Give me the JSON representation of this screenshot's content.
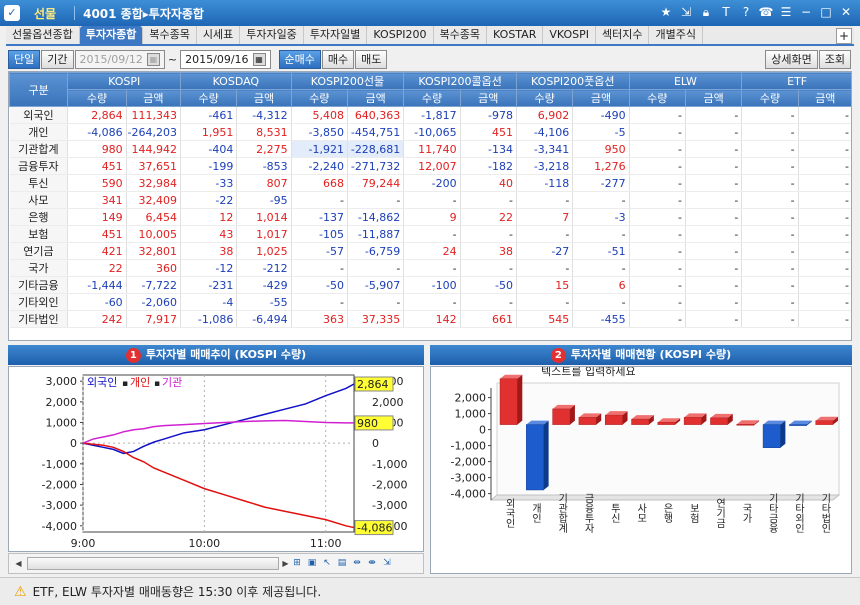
{
  "window": {
    "module": "선물",
    "screen_title": "4001 종합▸투자자종합"
  },
  "tabs": [
    "선물옵션종합",
    "투자자종합",
    "복수종목",
    "시세표",
    "투자자일중",
    "투자자일별",
    "KOSPI200",
    "복수종목",
    "KOSTAR",
    "VKOSPI",
    "섹터지수",
    "개별주식"
  ],
  "toolbar": {
    "single": "단일",
    "period": "기간",
    "date_from": "2015/09/12",
    "date_to": "2015/09/16",
    "tilde": "~",
    "net_buy": "순매수",
    "buy": "매수",
    "sell": "매도",
    "detail": "상세화면",
    "query": "조회"
  },
  "table": {
    "group_header": "구분",
    "groups": [
      "KOSPI",
      "KOSDAQ",
      "KOSPI200선물",
      "KOSPI200콜옵션",
      "KOSPI200풋옵션",
      "ELW",
      "ETF"
    ],
    "sub_qty": "수량",
    "sub_amt": "금액",
    "rows": [
      {
        "label": "외국인",
        "v": [
          "2,864",
          "111,343",
          "-461",
          "-4,312",
          "5,408",
          "640,363",
          "-1,817",
          "-978",
          "6,902",
          "-490",
          "-",
          "-",
          "-",
          "-"
        ]
      },
      {
        "label": "개인",
        "v": [
          "-4,086",
          "-264,203",
          "1,951",
          "8,531",
          "-3,850",
          "-454,751",
          "-10,065",
          "451",
          "-4,106",
          "-5",
          "-",
          "-",
          "-",
          "-"
        ]
      },
      {
        "label": "기관합계",
        "v": [
          "980",
          "144,942",
          "-404",
          "2,275",
          "-1,921",
          "-228,681",
          "11,740",
          "-134",
          "-3,341",
          "950",
          "-",
          "-",
          "-",
          "-"
        ]
      },
      {
        "label": "금융투자",
        "v": [
          "451",
          "37,651",
          "-199",
          "-853",
          "-2,240",
          "-271,732",
          "12,007",
          "-182",
          "-3,218",
          "1,276",
          "-",
          "-",
          "-",
          "-"
        ]
      },
      {
        "label": "투신",
        "v": [
          "590",
          "32,984",
          "-33",
          "807",
          "668",
          "79,244",
          "-200",
          "40",
          "-118",
          "-277",
          "-",
          "-",
          "-",
          "-"
        ]
      },
      {
        "label": "사모",
        "v": [
          "341",
          "32,409",
          "-22",
          "-95",
          "-",
          "-",
          "-",
          "-",
          "-",
          "-",
          "-",
          "-",
          "-",
          "-"
        ]
      },
      {
        "label": "은행",
        "v": [
          "149",
          "6,454",
          "12",
          "1,014",
          "-137",
          "-14,862",
          "9",
          "22",
          "7",
          "-3",
          "-",
          "-",
          "-",
          "-"
        ]
      },
      {
        "label": "보험",
        "v": [
          "451",
          "10,005",
          "43",
          "1,017",
          "-105",
          "-11,887",
          "-",
          "-",
          "-",
          "-",
          "-",
          "-",
          "-",
          "-"
        ]
      },
      {
        "label": "연기금",
        "v": [
          "421",
          "32,801",
          "38",
          "1,025",
          "-57",
          "-6,759",
          "24",
          "38",
          "-27",
          "-51",
          "-",
          "-",
          "-",
          "-"
        ]
      },
      {
        "label": "국가",
        "v": [
          "22",
          "360",
          "-12",
          "-212",
          "-",
          "-",
          "-",
          "-",
          "-",
          "-",
          "-",
          "-",
          "-",
          "-"
        ]
      },
      {
        "label": "기타금융",
        "v": [
          "-1,444",
          "-7,722",
          "-231",
          "-429",
          "-50",
          "-5,907",
          "-100",
          "-50",
          "15",
          "6",
          "-",
          "-",
          "-",
          "-"
        ]
      },
      {
        "label": "기타외인",
        "v": [
          "-60",
          "-2,060",
          "-4",
          "-55",
          "-",
          "-",
          "-",
          "-",
          "-",
          "-",
          "-",
          "-",
          "-",
          "-"
        ]
      },
      {
        "label": "기타법인",
        "v": [
          "242",
          "7,917",
          "-1,086",
          "-6,494",
          "363",
          "37,335",
          "142",
          "661",
          "545",
          "-455",
          "-",
          "-",
          "-",
          "-"
        ]
      }
    ]
  },
  "panel1": {
    "badge": "1",
    "title": "투자자별 매매추이 (KOSPI 수량)"
  },
  "panel2": {
    "badge": "2",
    "title": "투자자별 매매현황 (KOSPI 수량)"
  },
  "chart_data": [
    {
      "type": "line",
      "legend": [
        "외국인",
        "개인",
        "기관"
      ],
      "legend_sep": "▪",
      "colors": {
        "외국인": "#1010c8",
        "개인": "#e01010",
        "기관": "#d020d0"
      },
      "x_ticks": [
        "9:00",
        "10:00",
        "11:00"
      ],
      "ylim": [
        -4300,
        3300
      ],
      "y_ticks": [
        3000,
        2000,
        1000,
        0,
        -1000,
        -2000,
        -3000,
        -4000
      ],
      "y_tick_labels": [
        "3,000",
        "2,000",
        "1,000",
        "0",
        "-1,000",
        "-2,000",
        "-3,000",
        "-4,000"
      ],
      "last_value_labels": {
        "외국인": "2,864",
        "기관": "980",
        "개인": "-4,086"
      },
      "series": [
        {
          "name": "외국인",
          "x": [
            0,
            5,
            10,
            15,
            20,
            25,
            30,
            35,
            40,
            50,
            60,
            70,
            80,
            90,
            100,
            110,
            120,
            130,
            134
          ],
          "values": [
            0,
            -100,
            -200,
            -300,
            -500,
            -400,
            -150,
            50,
            200,
            500,
            650,
            900,
            1150,
            1400,
            1650,
            1900,
            2300,
            2650,
            2864
          ]
        },
        {
          "name": "개인",
          "x": [
            0,
            5,
            10,
            15,
            20,
            25,
            30,
            35,
            40,
            50,
            60,
            70,
            80,
            90,
            100,
            110,
            120,
            130,
            134
          ],
          "values": [
            0,
            -50,
            -100,
            -200,
            -400,
            -700,
            -900,
            -1200,
            -1400,
            -1800,
            -2200,
            -2500,
            -2800,
            -3100,
            -3300,
            -3500,
            -3700,
            -4000,
            -4086
          ]
        },
        {
          "name": "기관",
          "x": [
            0,
            5,
            10,
            15,
            20,
            25,
            30,
            35,
            40,
            50,
            60,
            70,
            80,
            90,
            100,
            110,
            120,
            130,
            134
          ],
          "values": [
            0,
            200,
            300,
            400,
            550,
            650,
            700,
            800,
            850,
            900,
            950,
            1000,
            1050,
            1080,
            1100,
            1050,
            1000,
            980,
            980
          ]
        }
      ]
    },
    {
      "type": "bar",
      "title": "텍스트를 입력하세요",
      "categories": [
        "외국인",
        "개인",
        "기관합계",
        "금융투자",
        "투신",
        "사모",
        "은행",
        "보험",
        "연기금",
        "국가",
        "기타금융",
        "기타외인",
        "기타법인"
      ],
      "values": [
        2864,
        -4086,
        980,
        451,
        590,
        341,
        149,
        451,
        421,
        22,
        -1444,
        -60,
        242
      ],
      "ylim": [
        -4400,
        2600
      ],
      "y_ticks": [
        2000,
        1000,
        0,
        -1000,
        -2000,
        -3000,
        -4000
      ],
      "y_tick_labels": [
        "2,000",
        "1,000",
        "0",
        "-1,000",
        "-2,000",
        "-3,000",
        "-4,000"
      ],
      "colors": {
        "positive": "#e03030",
        "negative": "#1c5ccc"
      }
    }
  ],
  "notice": "ETF, ELW 투자자별 매매동향은 15:30 이후 제공됩니다."
}
